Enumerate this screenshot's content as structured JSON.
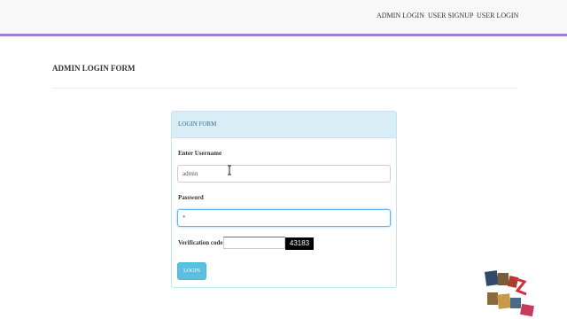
{
  "nav": {
    "items": [
      "ADMIN LOGIN",
      "USER SIGNUP",
      "USER LOGIN"
    ]
  },
  "page": {
    "title": "ADMIN LOGIN FORM"
  },
  "form": {
    "heading": "LOGIN FORM",
    "username_label": "Enter Username",
    "username_value": "admin",
    "password_label": "Password",
    "password_value": "*",
    "verification_label": "Verification code :",
    "verification_value": "",
    "captcha_code": "43183",
    "login_label": "LOGIN"
  },
  "icons": {
    "cursor": "text-cursor-icon",
    "watermark": "watermark-logo"
  },
  "colors": {
    "nav_accent": "#9c7fd8",
    "panel_heading_bg": "#d9edf7",
    "panel_border": "#bce8f1",
    "button_bg": "#5bc0de",
    "captcha_bg": "#000000"
  }
}
